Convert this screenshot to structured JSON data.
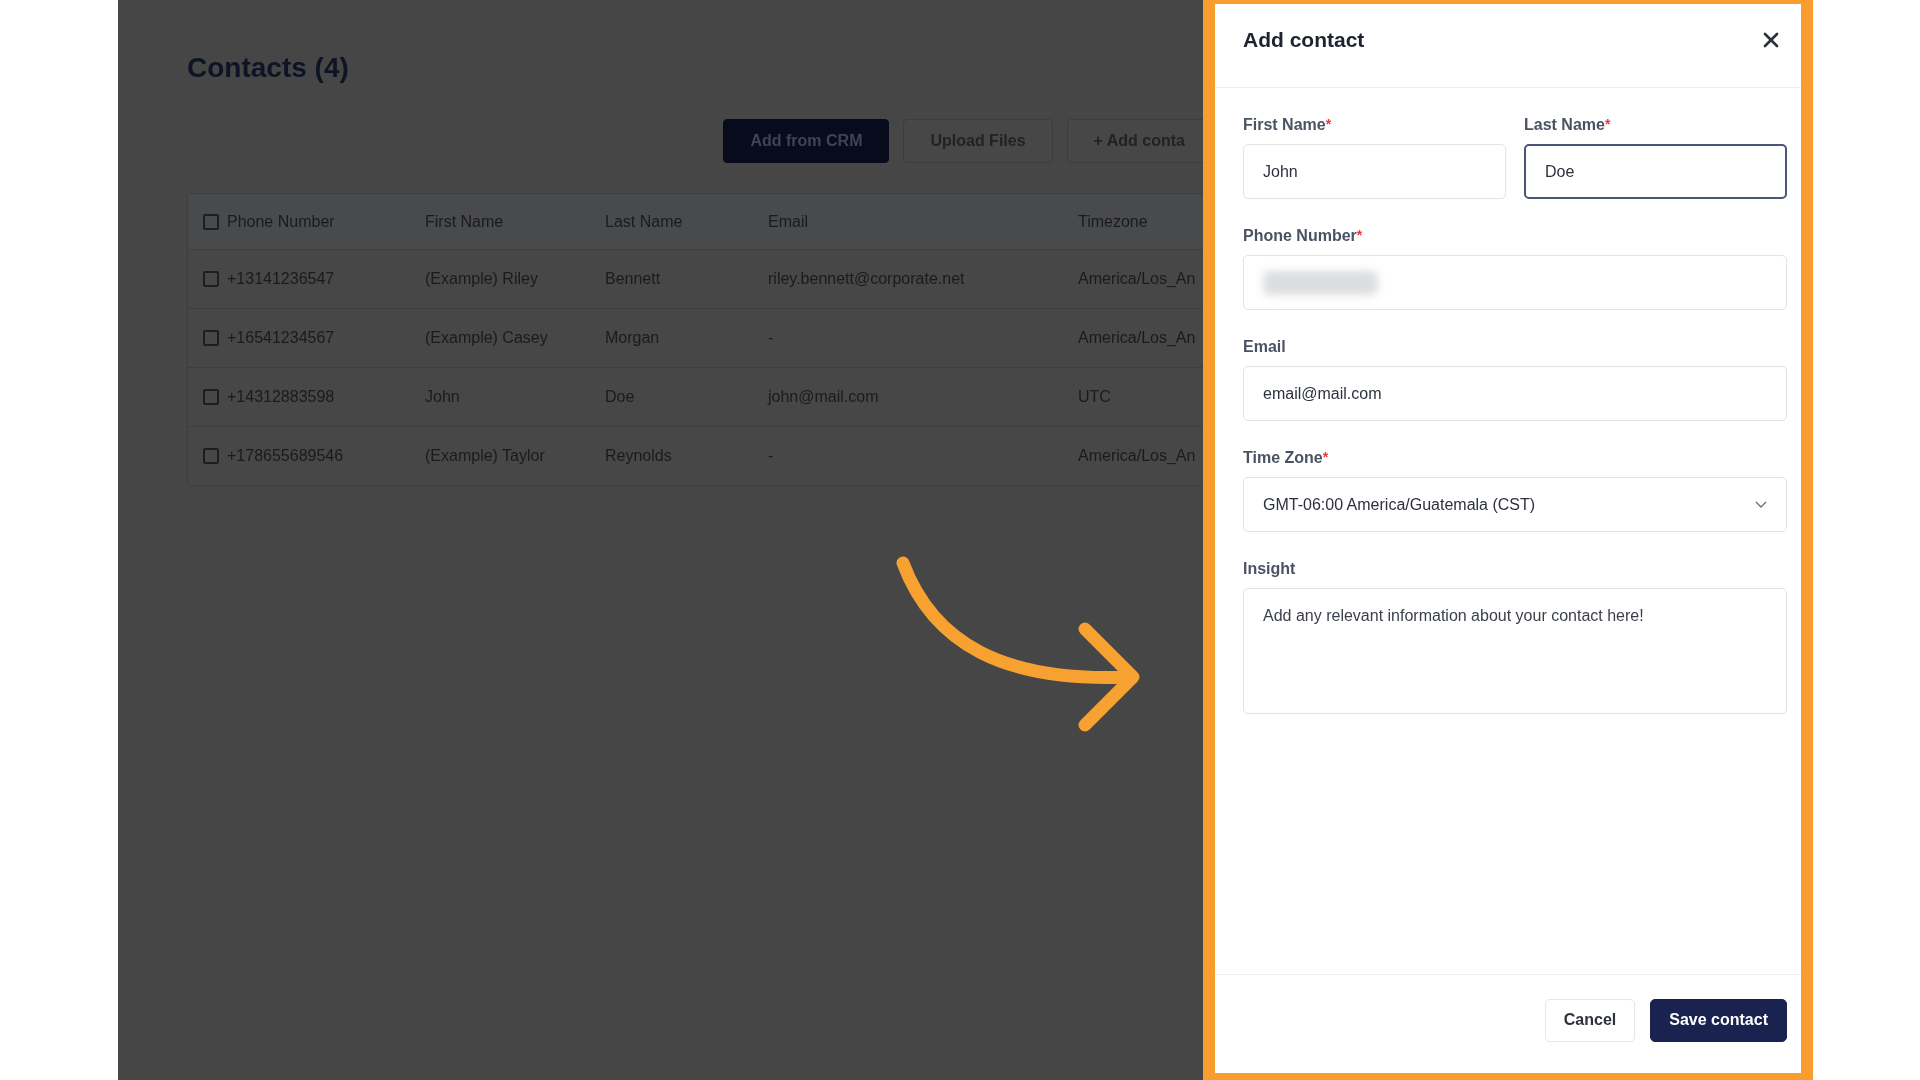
{
  "page": {
    "title": "Contacts (4)",
    "actions": [
      {
        "label": "Add from CRM",
        "kind": "primary"
      },
      {
        "label": "Upload Files",
        "kind": "secondary"
      },
      {
        "label": "+ Add conta",
        "kind": "secondary"
      }
    ],
    "table": {
      "header_checked": false,
      "columns": [
        "Phone Number",
        "First Name",
        "Last Name",
        "Email",
        "Timezone"
      ],
      "rows": [
        {
          "checked": false,
          "cells": [
            "+13141236547",
            "(Example) Riley",
            "Bennett",
            "riley.bennett@corporate.net",
            "America/Los_An"
          ]
        },
        {
          "checked": false,
          "cells": [
            "+16541234567",
            "(Example) Casey",
            "Morgan",
            "-",
            "America/Los_An"
          ]
        },
        {
          "checked": false,
          "cells": [
            "+14312883598",
            "John",
            "Doe",
            "john@mail.com",
            "UTC"
          ]
        },
        {
          "checked": false,
          "cells": [
            "+178655689546",
            "(Example) Taylor",
            "Reynolds",
            "-",
            "America/Los_An"
          ]
        }
      ]
    }
  },
  "dialog": {
    "title": "Add contact",
    "name_fields": [
      {
        "label": "First Name",
        "required_mark": "*",
        "value": "John",
        "focused": false
      },
      {
        "label": "Last Name",
        "required_mark": "*",
        "value": "Doe",
        "focused": true
      }
    ],
    "fields": [
      {
        "kind": "input",
        "label": "Phone Number",
        "required_mark": "*",
        "redacted": true
      },
      {
        "kind": "input",
        "label": "Email",
        "value": "email@mail.com"
      },
      {
        "kind": "select",
        "label": "Time Zone",
        "required_mark": "*",
        "value": "GMT-06:00 America/Guatemala (CST)"
      },
      {
        "kind": "textarea",
        "label": "Insight",
        "placeholder": "Add any relevant information about your contact here!"
      }
    ],
    "buttons": [
      {
        "label": "Cancel",
        "kind": "secondary"
      },
      {
        "label": "Save contact",
        "kind": "primary"
      }
    ]
  }
}
